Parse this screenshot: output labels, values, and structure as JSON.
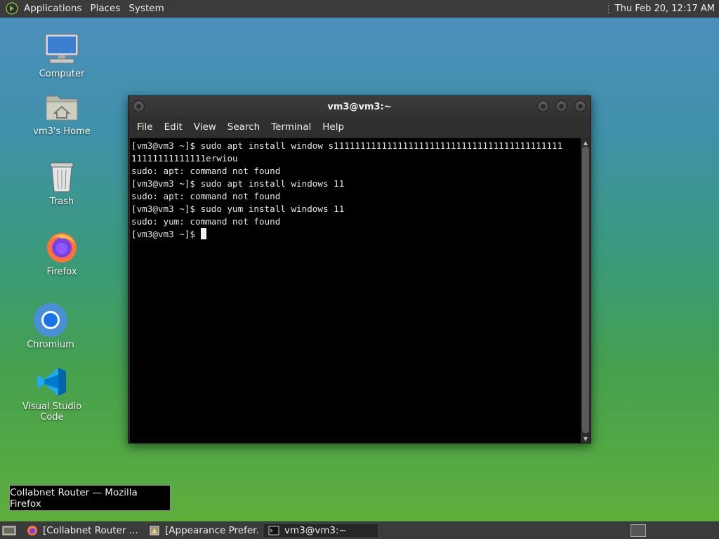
{
  "top_panel": {
    "menus": [
      "Applications",
      "Places",
      "System"
    ],
    "clock": "Thu Feb 20, 12:17 AM"
  },
  "desktop": {
    "icons": [
      {
        "label": "Computer",
        "icon": "computer-icon"
      },
      {
        "label": "vm3's Home",
        "icon": "home-folder-icon"
      },
      {
        "label": "Trash",
        "icon": "trash-icon"
      },
      {
        "label": "Firefox",
        "icon": "firefox-icon"
      },
      {
        "label": "Chromium",
        "icon": "chromium-icon"
      },
      {
        "label": "Visual Studio Code",
        "icon": "vscode-icon"
      }
    ]
  },
  "terminal": {
    "title": "vm3@vm3:~",
    "menu": [
      "File",
      "Edit",
      "View",
      "Search",
      "Terminal",
      "Help"
    ],
    "lines": [
      "[vm3@vm3 ~]$ sudo apt install window s1111111111111111111111111111111111111111111",
      "11111111111111erwiou",
      "sudo: apt: command not found",
      "[vm3@vm3 ~]$ sudo apt install windows 11",
      "sudo: apt: command not found",
      "[vm3@vm3 ~]$ sudo yum install windows 11",
      "sudo: yum: command not found"
    ],
    "prompt": "[vm3@vm3 ~]$ "
  },
  "tooltip": "Collabnet Router — Mozilla Firefox",
  "taskbar": {
    "tasks": [
      {
        "label": "[Collabnet Router ...",
        "icon": "firefox-icon"
      },
      {
        "label": "[Appearance Prefer...",
        "icon": "appearance-icon"
      },
      {
        "label": "vm3@vm3:~",
        "icon": "terminal-icon"
      }
    ]
  },
  "colors": {
    "panel": "#3b3b3b",
    "terminal_bg": "#000000",
    "terminal_fg": "#e6e6e6"
  }
}
